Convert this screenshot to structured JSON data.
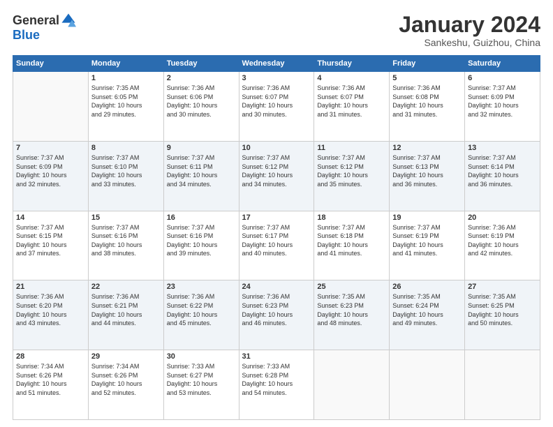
{
  "header": {
    "logo_general": "General",
    "logo_blue": "Blue",
    "month": "January 2024",
    "location": "Sankeshu, Guizhou, China"
  },
  "days_header": [
    "Sunday",
    "Monday",
    "Tuesday",
    "Wednesday",
    "Thursday",
    "Friday",
    "Saturday"
  ],
  "weeks": [
    {
      "shade": "white",
      "days": [
        {
          "num": "",
          "info": ""
        },
        {
          "num": "1",
          "info": "Sunrise: 7:35 AM\nSunset: 6:05 PM\nDaylight: 10 hours\nand 29 minutes."
        },
        {
          "num": "2",
          "info": "Sunrise: 7:36 AM\nSunset: 6:06 PM\nDaylight: 10 hours\nand 30 minutes."
        },
        {
          "num": "3",
          "info": "Sunrise: 7:36 AM\nSunset: 6:07 PM\nDaylight: 10 hours\nand 30 minutes."
        },
        {
          "num": "4",
          "info": "Sunrise: 7:36 AM\nSunset: 6:07 PM\nDaylight: 10 hours\nand 31 minutes."
        },
        {
          "num": "5",
          "info": "Sunrise: 7:36 AM\nSunset: 6:08 PM\nDaylight: 10 hours\nand 31 minutes."
        },
        {
          "num": "6",
          "info": "Sunrise: 7:37 AM\nSunset: 6:09 PM\nDaylight: 10 hours\nand 32 minutes."
        }
      ]
    },
    {
      "shade": "shade",
      "days": [
        {
          "num": "7",
          "info": "Sunrise: 7:37 AM\nSunset: 6:09 PM\nDaylight: 10 hours\nand 32 minutes."
        },
        {
          "num": "8",
          "info": "Sunrise: 7:37 AM\nSunset: 6:10 PM\nDaylight: 10 hours\nand 33 minutes."
        },
        {
          "num": "9",
          "info": "Sunrise: 7:37 AM\nSunset: 6:11 PM\nDaylight: 10 hours\nand 34 minutes."
        },
        {
          "num": "10",
          "info": "Sunrise: 7:37 AM\nSunset: 6:12 PM\nDaylight: 10 hours\nand 34 minutes."
        },
        {
          "num": "11",
          "info": "Sunrise: 7:37 AM\nSunset: 6:12 PM\nDaylight: 10 hours\nand 35 minutes."
        },
        {
          "num": "12",
          "info": "Sunrise: 7:37 AM\nSunset: 6:13 PM\nDaylight: 10 hours\nand 36 minutes."
        },
        {
          "num": "13",
          "info": "Sunrise: 7:37 AM\nSunset: 6:14 PM\nDaylight: 10 hours\nand 36 minutes."
        }
      ]
    },
    {
      "shade": "white",
      "days": [
        {
          "num": "14",
          "info": "Sunrise: 7:37 AM\nSunset: 6:15 PM\nDaylight: 10 hours\nand 37 minutes."
        },
        {
          "num": "15",
          "info": "Sunrise: 7:37 AM\nSunset: 6:16 PM\nDaylight: 10 hours\nand 38 minutes."
        },
        {
          "num": "16",
          "info": "Sunrise: 7:37 AM\nSunset: 6:16 PM\nDaylight: 10 hours\nand 39 minutes."
        },
        {
          "num": "17",
          "info": "Sunrise: 7:37 AM\nSunset: 6:17 PM\nDaylight: 10 hours\nand 40 minutes."
        },
        {
          "num": "18",
          "info": "Sunrise: 7:37 AM\nSunset: 6:18 PM\nDaylight: 10 hours\nand 41 minutes."
        },
        {
          "num": "19",
          "info": "Sunrise: 7:37 AM\nSunset: 6:19 PM\nDaylight: 10 hours\nand 41 minutes."
        },
        {
          "num": "20",
          "info": "Sunrise: 7:36 AM\nSunset: 6:19 PM\nDaylight: 10 hours\nand 42 minutes."
        }
      ]
    },
    {
      "shade": "shade",
      "days": [
        {
          "num": "21",
          "info": "Sunrise: 7:36 AM\nSunset: 6:20 PM\nDaylight: 10 hours\nand 43 minutes."
        },
        {
          "num": "22",
          "info": "Sunrise: 7:36 AM\nSunset: 6:21 PM\nDaylight: 10 hours\nand 44 minutes."
        },
        {
          "num": "23",
          "info": "Sunrise: 7:36 AM\nSunset: 6:22 PM\nDaylight: 10 hours\nand 45 minutes."
        },
        {
          "num": "24",
          "info": "Sunrise: 7:36 AM\nSunset: 6:23 PM\nDaylight: 10 hours\nand 46 minutes."
        },
        {
          "num": "25",
          "info": "Sunrise: 7:35 AM\nSunset: 6:23 PM\nDaylight: 10 hours\nand 48 minutes."
        },
        {
          "num": "26",
          "info": "Sunrise: 7:35 AM\nSunset: 6:24 PM\nDaylight: 10 hours\nand 49 minutes."
        },
        {
          "num": "27",
          "info": "Sunrise: 7:35 AM\nSunset: 6:25 PM\nDaylight: 10 hours\nand 50 minutes."
        }
      ]
    },
    {
      "shade": "white",
      "days": [
        {
          "num": "28",
          "info": "Sunrise: 7:34 AM\nSunset: 6:26 PM\nDaylight: 10 hours\nand 51 minutes."
        },
        {
          "num": "29",
          "info": "Sunrise: 7:34 AM\nSunset: 6:26 PM\nDaylight: 10 hours\nand 52 minutes."
        },
        {
          "num": "30",
          "info": "Sunrise: 7:33 AM\nSunset: 6:27 PM\nDaylight: 10 hours\nand 53 minutes."
        },
        {
          "num": "31",
          "info": "Sunrise: 7:33 AM\nSunset: 6:28 PM\nDaylight: 10 hours\nand 54 minutes."
        },
        {
          "num": "",
          "info": ""
        },
        {
          "num": "",
          "info": ""
        },
        {
          "num": "",
          "info": ""
        }
      ]
    }
  ]
}
